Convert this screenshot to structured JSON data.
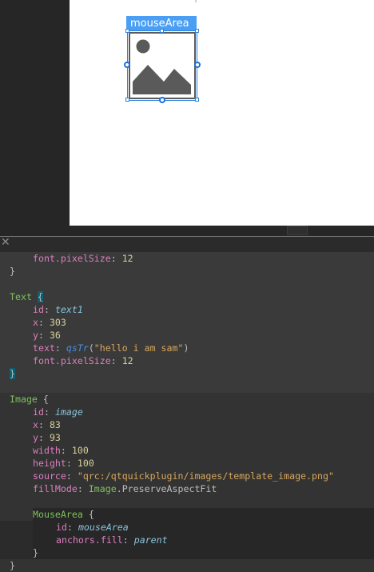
{
  "designer": {
    "selected_item_label": "mouseArea",
    "selected_item_icon": "image-placeholder-icon",
    "selection_color": "#4a9ff5"
  },
  "editor": {
    "close_glyph": "✕",
    "line_font_pixelsize_1": {
      "prop": "font.pixelSize",
      "value": "12"
    },
    "closing_brace_1": "}",
    "text_block": {
      "type": "Text",
      "open_brace": "{",
      "id_prop": "id",
      "id_value": "text1",
      "x_prop": "x",
      "x_value": "303",
      "y_prop": "y",
      "y_value": "36",
      "text_prop": "text",
      "text_fn": "qsTr",
      "text_open": "(",
      "text_string": "\"hello i am sam\"",
      "text_close": ")",
      "font_prop": "font.pixelSize",
      "font_value": "12",
      "close_brace": "}"
    },
    "image_block": {
      "type": "Image",
      "open_brace": "{",
      "id_prop": "id",
      "id_value": "image",
      "x_prop": "x",
      "x_value": "83",
      "y_prop": "y",
      "y_value": "93",
      "width_prop": "width",
      "width_value": "100",
      "height_prop": "height",
      "height_value": "100",
      "source_prop": "source",
      "source_value": "\"qrc:/qtquickplugin/images/template_image.png\"",
      "fillmode_prop": "fillMode",
      "fillmode_type": "Image",
      "fillmode_value": ".PreserveAspectFit"
    },
    "mousearea_block": {
      "type": "MouseArea",
      "open_brace": "{",
      "id_prop": "id",
      "id_value": "mouseArea",
      "anchors_prop": "anchors.fill",
      "anchors_value": "parent",
      "close_brace": "}"
    },
    "final_brace": "}"
  }
}
